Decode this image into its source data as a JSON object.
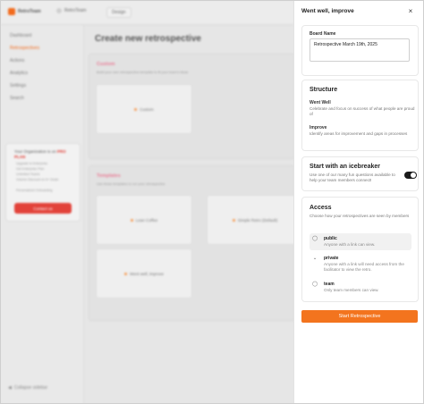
{
  "app": {
    "logo_text": "RetroTeam",
    "workspace": "RetroTeam",
    "design_tab": "Design"
  },
  "sidebar": {
    "items": [
      {
        "label": "Dashboard"
      },
      {
        "label": "Retrospectives"
      },
      {
        "label": "Actions"
      },
      {
        "label": "Analytics"
      },
      {
        "label": "Settings"
      },
      {
        "label": "Search"
      }
    ],
    "promo": {
      "title_prefix": "Your Organization is on",
      "title_plan": "PRO PLAN",
      "features": [
        "Upgrade to Enterprise",
        "Get Enterprise Plan",
        "Unlimited Teams",
        "Volume Discount on 5+ Seats",
        "Personalized Onboarding"
      ],
      "button_label": "Contact us"
    },
    "collapse_label": "Collapse sidebar"
  },
  "main": {
    "title": "Create new retrospective",
    "custom_section": {
      "heading": "Custom",
      "subtitle": "Build your own retrospective template to fit your team's ideas",
      "card_label": "Custom"
    },
    "templates_section": {
      "heading": "Templates",
      "subtitle": "Use these templates to run your retrospective",
      "cards": [
        {
          "label": "Lean Coffee"
        },
        {
          "label": "Simple Retro (Default)"
        },
        {
          "label": "Went well, improve"
        }
      ]
    }
  },
  "panel": {
    "title": "Went well, improve",
    "board_name_label": "Board Name",
    "board_name_value": "Retrospective March 19th, 2025",
    "structure": {
      "heading": "Structure",
      "columns": [
        {
          "name": "Went Well",
          "desc": "Celebrate and focus on success of what people are proud of"
        },
        {
          "name": "Improve",
          "desc": "Identify areas for improvement and gaps in processes"
        }
      ]
    },
    "icebreaker": {
      "heading": "Start with an icebreaker",
      "desc": "Use one of our many fun questions available to help your team members connect!",
      "enabled": true
    },
    "access": {
      "heading": "Access",
      "desc": "Choose how your retrospectives are seen by members",
      "options": [
        {
          "name": "public",
          "desc": "Anyone with a link can view.",
          "icon": "user-icon",
          "selected": true
        },
        {
          "name": "private",
          "desc": "Anyone with a link will need access from the facilitator to view the retro.",
          "icon": "chevron-down-icon",
          "selected": false
        },
        {
          "name": "team",
          "desc": "Only team members can view.",
          "icon": "users-icon",
          "selected": false
        }
      ]
    },
    "submit_label": "Start Retrospective"
  },
  "colors": {
    "accent": "#f3741e",
    "promo_button": "#e2423a",
    "toggle_on": "#1a1a1a"
  }
}
